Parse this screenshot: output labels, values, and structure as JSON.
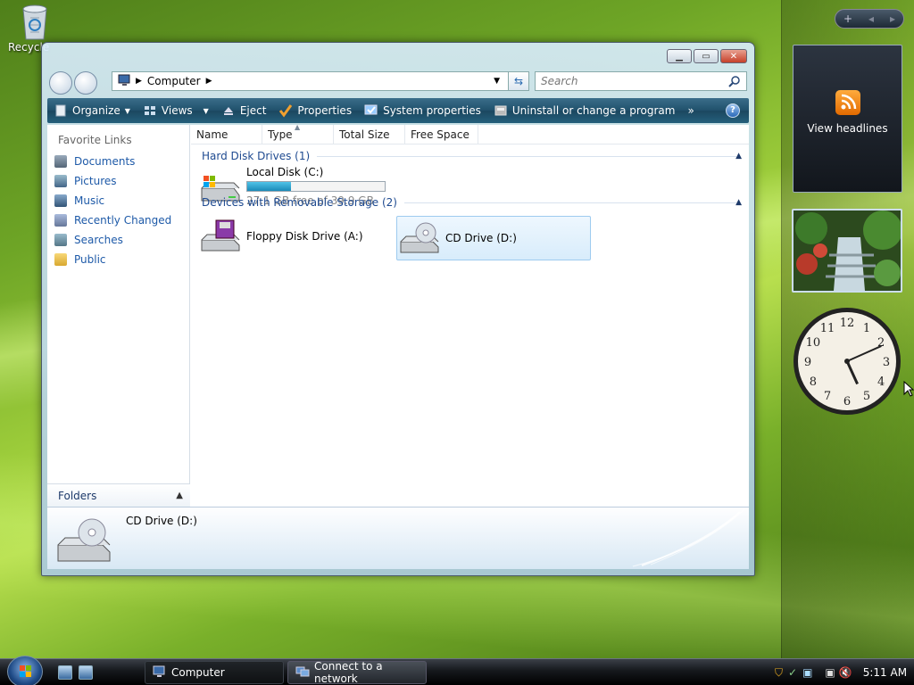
{
  "desktop": {
    "recycle_label": "Recycle"
  },
  "window": {
    "address": {
      "location": "Computer"
    },
    "search_placeholder": "Search",
    "toolbar": {
      "organize": "Organize",
      "views": "Views",
      "eject": "Eject",
      "properties": "Properties",
      "system_properties": "System properties",
      "uninstall": "Uninstall or change a program",
      "more": "»"
    },
    "nav_pane": {
      "header": "Favorite Links",
      "links": [
        "Documents",
        "Pictures",
        "Music",
        "Recently Changed",
        "Searches",
        "Public"
      ],
      "folders_label": "Folders"
    },
    "columns": [
      "Name",
      "Type",
      "Total Size",
      "Free Space"
    ],
    "groups": {
      "hard_disk": {
        "title": "Hard Disk Drives (1)",
        "drives": [
          {
            "name": "Local Disk (C:)",
            "free_text": "27.1 GB free of 39.9 GB",
            "used_fraction": 0.32
          }
        ]
      },
      "removable": {
        "title": "Devices with Removable Storage (2)",
        "drives": [
          {
            "name": "Floppy Disk Drive (A:)"
          },
          {
            "name": "CD Drive (D:)"
          }
        ]
      }
    },
    "details": {
      "selected_name": "CD Drive (D:)"
    }
  },
  "sidebar": {
    "feed_label": "View headlines",
    "clock": {
      "hour": 5,
      "minute": 11
    }
  },
  "taskbar": {
    "tasks": [
      {
        "label": "Computer"
      },
      {
        "label": "Connect to a network"
      }
    ],
    "time": "5:11 AM"
  }
}
